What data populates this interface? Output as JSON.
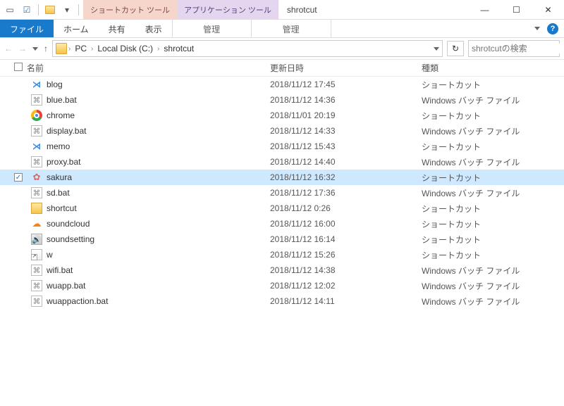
{
  "title": "shrotcut",
  "context_tabs": [
    {
      "label": "ショートカット ツール",
      "sub": "管理"
    },
    {
      "label": "アプリケーション ツール",
      "sub": "管理"
    }
  ],
  "ribbon": {
    "file": "ファイル",
    "home": "ホーム",
    "share": "共有",
    "view": "表示"
  },
  "breadcrumb": [
    "PC",
    "Local Disk (C:)",
    "shrotcut"
  ],
  "search_placeholder": "shrotcutの検索",
  "columns": {
    "name": "名前",
    "date": "更新日時",
    "type": "種類"
  },
  "type_labels": {
    "shortcut": "ショートカット",
    "bat": "Windows バッチ ファイル"
  },
  "files": [
    {
      "name": "blog",
      "date": "2018/11/12 17:45",
      "type": "shortcut",
      "icon": "vscode"
    },
    {
      "name": "blue.bat",
      "date": "2018/11/12 14:36",
      "type": "bat",
      "icon": "bat"
    },
    {
      "name": "chrome",
      "date": "2018/11/01 20:19",
      "type": "shortcut",
      "icon": "chrome"
    },
    {
      "name": "display.bat",
      "date": "2018/11/12 14:33",
      "type": "bat",
      "icon": "bat"
    },
    {
      "name": "memo",
      "date": "2018/11/12 15:43",
      "type": "shortcut",
      "icon": "vscode"
    },
    {
      "name": "proxy.bat",
      "date": "2018/11/12 14:40",
      "type": "bat",
      "icon": "bat"
    },
    {
      "name": "sakura",
      "date": "2018/11/12 16:32",
      "type": "shortcut",
      "icon": "sakura",
      "selected": true,
      "checked": true
    },
    {
      "name": "sd.bat",
      "date": "2018/11/12 17:36",
      "type": "bat",
      "icon": "bat"
    },
    {
      "name": "shortcut",
      "date": "2018/11/12 0:26",
      "type": "shortcut",
      "icon": "folder"
    },
    {
      "name": "soundcloud",
      "date": "2018/11/12 16:00",
      "type": "shortcut",
      "icon": "cloud"
    },
    {
      "name": "soundsetting",
      "date": "2018/11/12 16:14",
      "type": "shortcut",
      "icon": "sound"
    },
    {
      "name": "w",
      "date": "2018/11/12 15:26",
      "type": "shortcut",
      "icon": "shortcut"
    },
    {
      "name": "wifi.bat",
      "date": "2018/11/12 14:38",
      "type": "bat",
      "icon": "bat"
    },
    {
      "name": "wuapp.bat",
      "date": "2018/11/12 12:02",
      "type": "bat",
      "icon": "bat"
    },
    {
      "name": "wuappaction.bat",
      "date": "2018/11/12 14:11",
      "type": "bat",
      "icon": "bat"
    }
  ]
}
